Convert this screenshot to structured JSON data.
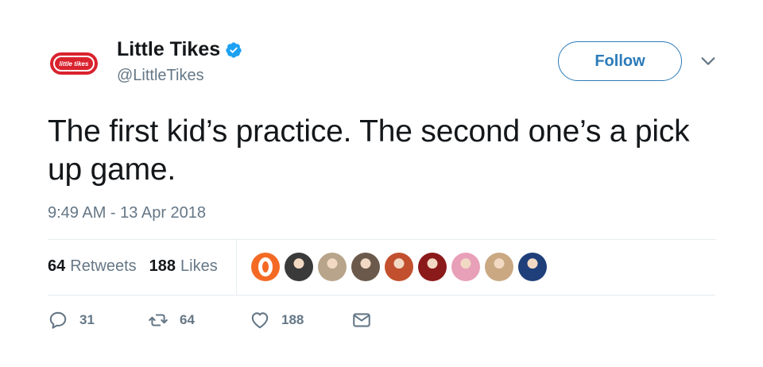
{
  "author": {
    "display_name": "Little Tikes",
    "handle": "@LittleTikes",
    "avatar_text": "little tikes"
  },
  "header": {
    "follow_label": "Follow"
  },
  "tweet": {
    "text": "The first kid’s practice. The second one’s a pick up game.",
    "timestamp": "9:49 AM - 13 Apr 2018"
  },
  "stats": {
    "retweets_count": "64",
    "retweets_label": "Retweets",
    "likes_count": "188",
    "likes_label": "Likes"
  },
  "likers": [
    {
      "name": "liker-1",
      "color": "#f46a25"
    },
    {
      "name": "liker-2",
      "color": "#3a3a3a"
    },
    {
      "name": "liker-3",
      "color": "#b8a48a"
    },
    {
      "name": "liker-4",
      "color": "#6b5a4c"
    },
    {
      "name": "liker-5",
      "color": "#c2502e"
    },
    {
      "name": "liker-6",
      "color": "#8b1a1a"
    },
    {
      "name": "liker-7",
      "color": "#e7a0b7"
    },
    {
      "name": "liker-8",
      "color": "#c9a882"
    },
    {
      "name": "liker-9",
      "color": "#1f3f7a"
    }
  ],
  "actions": {
    "reply_count": "31",
    "retweet_count": "64",
    "like_count": "188"
  },
  "colors": {
    "accent": "#2b7bb9",
    "verified": "#1da1f2",
    "secondary_text": "#657786",
    "brand_red": "#d9232e"
  }
}
